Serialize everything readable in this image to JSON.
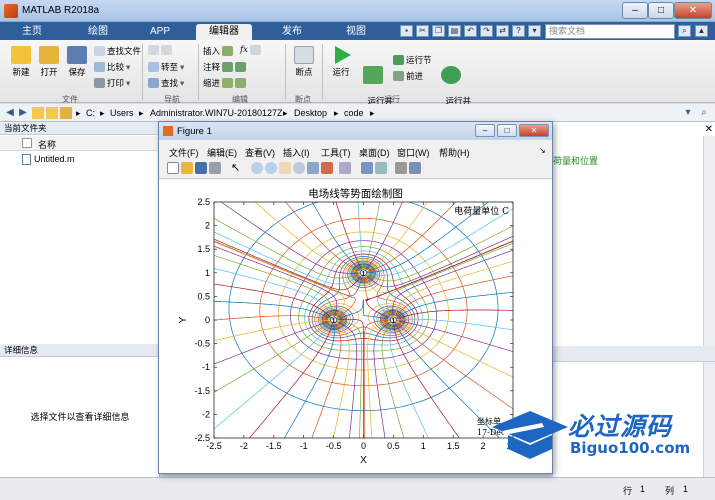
{
  "window": {
    "title": "MATLAB R2018a",
    "buttons": {
      "minimize": "–",
      "maximize": "□",
      "close": "✕"
    }
  },
  "ribbon_tabs": [
    "主页",
    "绘图",
    "APP",
    "编辑器",
    "发布",
    "视图"
  ],
  "search": {
    "placeholder": "搜索文档"
  },
  "ribbon": {
    "file": {
      "new": "新建",
      "open": "打开",
      "save": "保存",
      "find_files": "查找文件",
      "compare": "比较",
      "print": "打印",
      "label": "文件"
    },
    "navigate": {
      "goto": "转至",
      "find": "查找",
      "label": "导航"
    },
    "edit": {
      "insert": "插入",
      "comment": "注释",
      "indent": "缩进",
      "fx": "fx",
      "label": "编辑"
    },
    "breakpoints": {
      "breakpoints": "断点",
      "label": "断点"
    },
    "run": {
      "run": "运行",
      "run_advance": "运行并\n前进",
      "run_section": "运行节",
      "advance": "前进",
      "run_time": "运行并\n计时",
      "label": "运行"
    }
  },
  "address_bar": {
    "path": [
      "C:",
      "Users",
      "Administrator.WIN7U-20180127Z",
      "Desktop",
      "code"
    ]
  },
  "current_folder": {
    "header": "当前文件夹",
    "column_name": "名称",
    "files": [
      "Untitled.m"
    ]
  },
  "details": {
    "header": "详细信息",
    "hint": "选择文件以查看详细信息"
  },
  "right_pane": {
    "snippet": "荷量和位置"
  },
  "status_bar": {
    "row_label": "行",
    "row_value": "1",
    "col_label": "列",
    "col_value": "1"
  },
  "figure": {
    "title": "Figure 1",
    "menu": [
      "文件(F)",
      "编辑(E)",
      "查看(V)",
      "插入(I)",
      "工具(T)",
      "桌面(D)",
      "窗口(W)",
      "帮助(H)"
    ],
    "buttons": {
      "minimize": "–",
      "maximize": "□",
      "close": "✕"
    }
  },
  "chart_data": {
    "type": "line",
    "title": "电场线等势面绘制图",
    "xlabel": "X",
    "ylabel": "Y",
    "xlim": [
      -2.5,
      2.5
    ],
    "ylim": [
      -2.5,
      2.5
    ],
    "x_ticks": [
      "-2.5",
      "-2",
      "-1.5",
      "-1",
      "-0.5",
      "0",
      "0.5",
      "1",
      "1.5",
      "2",
      "2.5"
    ],
    "y_ticks": [
      "2.5",
      "2",
      "1.5",
      "1",
      "0.5",
      "0",
      "-0.5",
      "-1",
      "-1.5",
      "-2",
      "-2.5"
    ],
    "annotation_top": "电荷量单位 C",
    "annotation_bottom_1": "坐标单",
    "annotation_bottom_2": "17-Dec",
    "charges": [
      {
        "x": 0,
        "y": 1,
        "label": "1"
      },
      {
        "x": -0.5,
        "y": 0,
        "label": "1"
      },
      {
        "x": 0.5,
        "y": 0,
        "label": "1"
      }
    ],
    "grid": false
  },
  "watermark": {
    "main": "必过源码",
    "sub": "Biguo100.com"
  }
}
